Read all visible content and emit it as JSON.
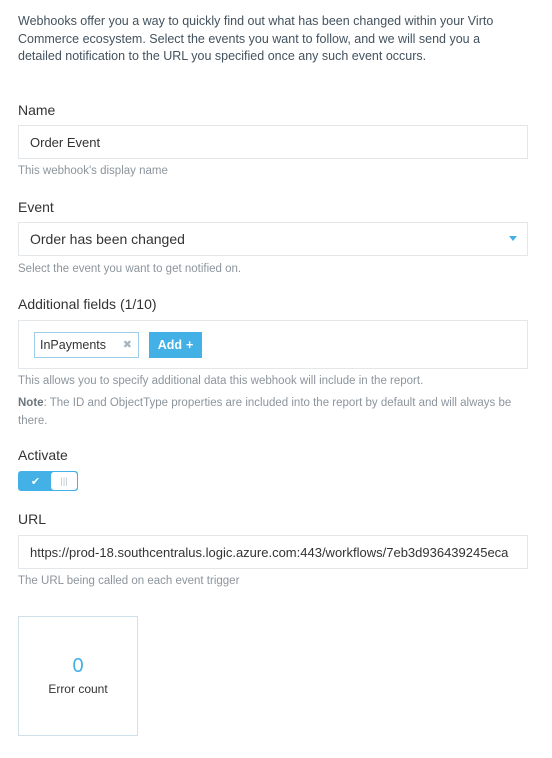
{
  "intro": "Webhooks offer you a way to quickly find out what has been changed within your Virto Commerce ecosystem. Select the events you want to follow, and we will send you a detailed notification to the URL you specified once any such event occurs.",
  "name": {
    "label": "Name",
    "value": "Order Event",
    "hint": "This webhook's display name"
  },
  "event": {
    "label": "Event",
    "value": "Order has been changed",
    "hint": "Select the event you want to get notified on."
  },
  "additional_fields": {
    "label": "Additional fields (1/10)",
    "tags": [
      "InPayments"
    ],
    "add_label": "Add",
    "hint": "This allows you to specify additional data this webhook will include in the report.",
    "note_label": "Note",
    "note_text": ": The ID and ObjectType properties are included into the report by default and will always be there."
  },
  "activate": {
    "label": "Activate",
    "checked": true
  },
  "url": {
    "label": "URL",
    "value": "https://prod-18.southcentralus.logic.azure.com:443/workflows/7eb3d936439245eca",
    "hint": "The URL being called on each event trigger"
  },
  "stats": {
    "error_count_value": "0",
    "error_count_label": "Error count"
  },
  "colors": {
    "accent": "#43b0e6",
    "border": "#e3e7ea",
    "hint": "#8c959c"
  },
  "icons": {
    "select_arrow": "chevron-down-icon",
    "tag_remove": "close-icon",
    "add": "plus-icon",
    "toggle_check": "check-icon",
    "toggle_grip": "grip-icon"
  }
}
